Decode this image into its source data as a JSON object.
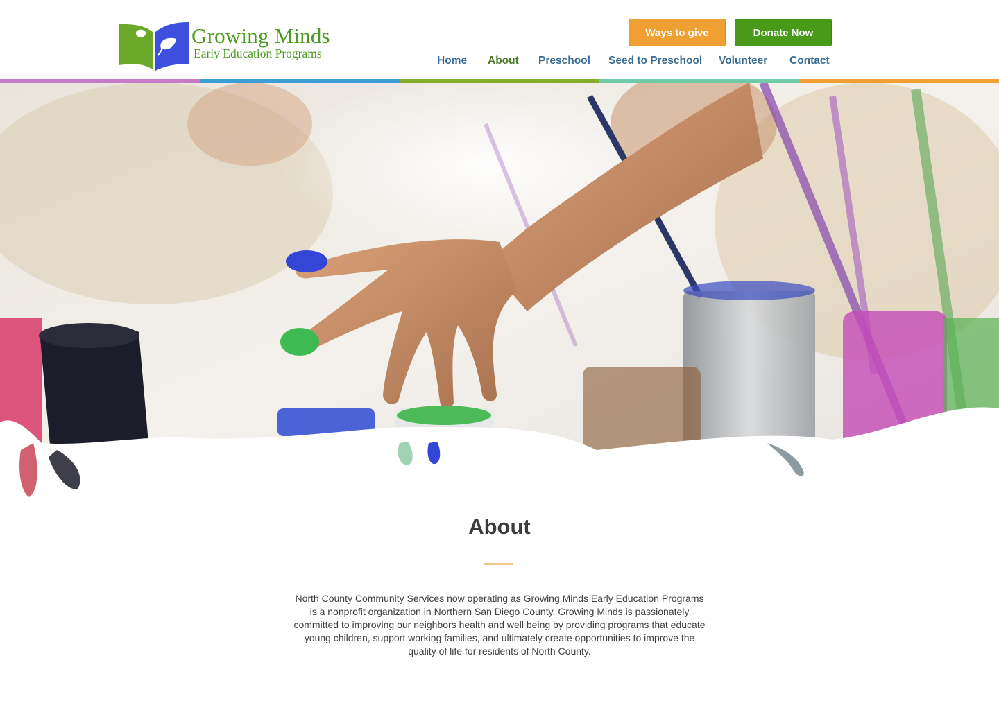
{
  "logo": {
    "title": "Growing Minds",
    "subtitle": "Early Education Programs",
    "icon": "book-leaf-logo-icon"
  },
  "header": {
    "ways_to_give": "Ways to give",
    "donate_now": "Donate Now"
  },
  "nav": {
    "items": [
      {
        "label": "Home"
      },
      {
        "label": "About"
      },
      {
        "label": "Preschool"
      },
      {
        "label": "Seed to Preschool"
      },
      {
        "label": "Volunteer"
      },
      {
        "label": "Contact"
      }
    ],
    "active": "About"
  },
  "colors": {
    "brand_green": "#4c9a1f",
    "brand_blue": "#3e4fe0",
    "nav_blue": "#3a6d96",
    "button_orange": "#f0a033",
    "button_green": "#4a9a19",
    "stripe": [
      "#c87ac8",
      "#3d9ed6",
      "#86ad2c",
      "#6fcba6",
      "#f0a033"
    ]
  },
  "about": {
    "title": "About",
    "body": "North County Community Services now operating as Growing Minds Early Education Programs is a nonprofit organization in Northern San Diego County.  Growing Minds is passionately committed to improving our neighbors health and well being by providing programs that educate young children, support working families, and ultimately create opportunities to improve the quality of life for residents of North County."
  }
}
